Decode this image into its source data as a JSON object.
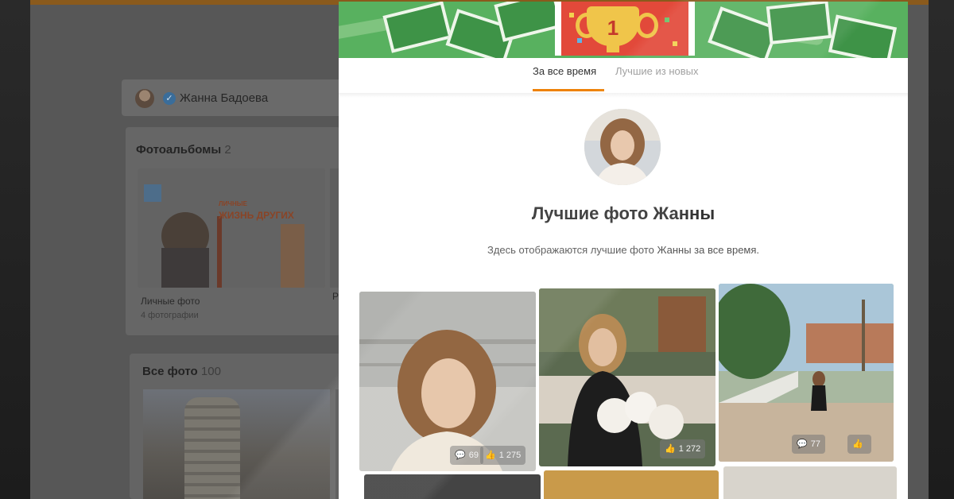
{
  "background_page": {
    "profile_name": "Жанна Бадоева",
    "albums_title": "Фотоальбомы",
    "albums_count": "2",
    "album_banner_top": "ЛИЧНЫЕ",
    "album_banner_main": "ЖИЗНЬ ДРУГИХ",
    "album_name": "Личные фото",
    "album_sub": "4 фотографии",
    "album2_name_partial": "Р",
    "all_photos_title": "Все фото",
    "all_photos_count": "100"
  },
  "modal": {
    "trophy_number": "1",
    "tabs": [
      {
        "label": "За все время",
        "active": true
      },
      {
        "label": "Лучшие из новых",
        "active": false
      }
    ],
    "title": "Лучшие фото Жанны",
    "subtitle": "Здесь отображаются лучшие фото Жанны за все время.",
    "photos": [
      {
        "comments": "69",
        "likes": "1 275"
      },
      {
        "comments": "",
        "likes": "1 272"
      },
      {
        "comments": "77",
        "likes": ""
      }
    ]
  },
  "colors": {
    "accent_orange": "#ee8208",
    "banner_green": "#58b15f",
    "trophy_red": "#e2493a",
    "trophy_gold": "#f0c54a"
  }
}
